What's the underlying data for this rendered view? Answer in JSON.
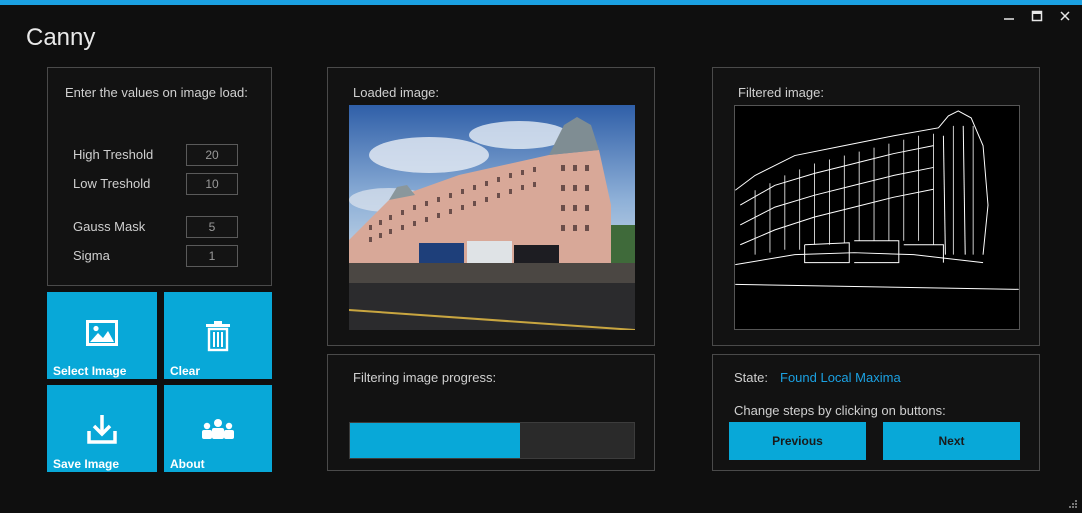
{
  "window": {
    "title": "Canny",
    "controls": {
      "minimize": "—",
      "maximize": "☐",
      "close": "✕"
    },
    "accent": "#1ba1e2"
  },
  "params": {
    "header": "Enter the values on image load:",
    "high_threshold": {
      "label": "High Treshold",
      "value": "20"
    },
    "low_threshold": {
      "label": "Low Treshold",
      "value": "10"
    },
    "gauss_mask": {
      "label": "Gauss Mask",
      "value": "5"
    },
    "sigma": {
      "label": "Sigma",
      "value": "1"
    }
  },
  "tiles": {
    "select_image": {
      "label": "Select Image",
      "icon": "image-icon"
    },
    "clear": {
      "label": "Clear",
      "icon": "trash-icon"
    },
    "save_image": {
      "label": "Save Image",
      "icon": "download-icon"
    },
    "about": {
      "label": "About",
      "icon": "people-icon"
    }
  },
  "loaded": {
    "label": "Loaded image:"
  },
  "filtered": {
    "label": "Filtered image:"
  },
  "progress": {
    "label": "Filtering image progress:",
    "fraction": 0.6
  },
  "state": {
    "label": "State:",
    "value": "Found Local Maxima",
    "value_color": "#1ba1e2",
    "hint": "Change steps by clicking on buttons:",
    "previous": "Previous",
    "next": "Next"
  }
}
